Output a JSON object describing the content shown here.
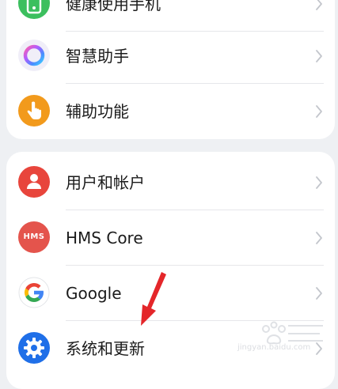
{
  "card1": {
    "items": [
      {
        "label": "健康使用手机",
        "icon": "health-icon"
      },
      {
        "label": "智慧助手",
        "icon": "assistant-icon"
      },
      {
        "label": "辅助功能",
        "icon": "accessibility-icon"
      }
    ]
  },
  "card2": {
    "items": [
      {
        "label": "用户和帐户",
        "icon": "user-icon"
      },
      {
        "label": "HMS Core",
        "icon": "hms-icon",
        "icon_text": "HMS"
      },
      {
        "label": "Google",
        "icon": "google-icon"
      },
      {
        "label": "系统和更新",
        "icon": "gear-icon"
      }
    ]
  },
  "watermark": {
    "text": "jingyan.baidu.com"
  },
  "colors": {
    "background": "#eef0f3",
    "arrow": "#e4262a"
  }
}
